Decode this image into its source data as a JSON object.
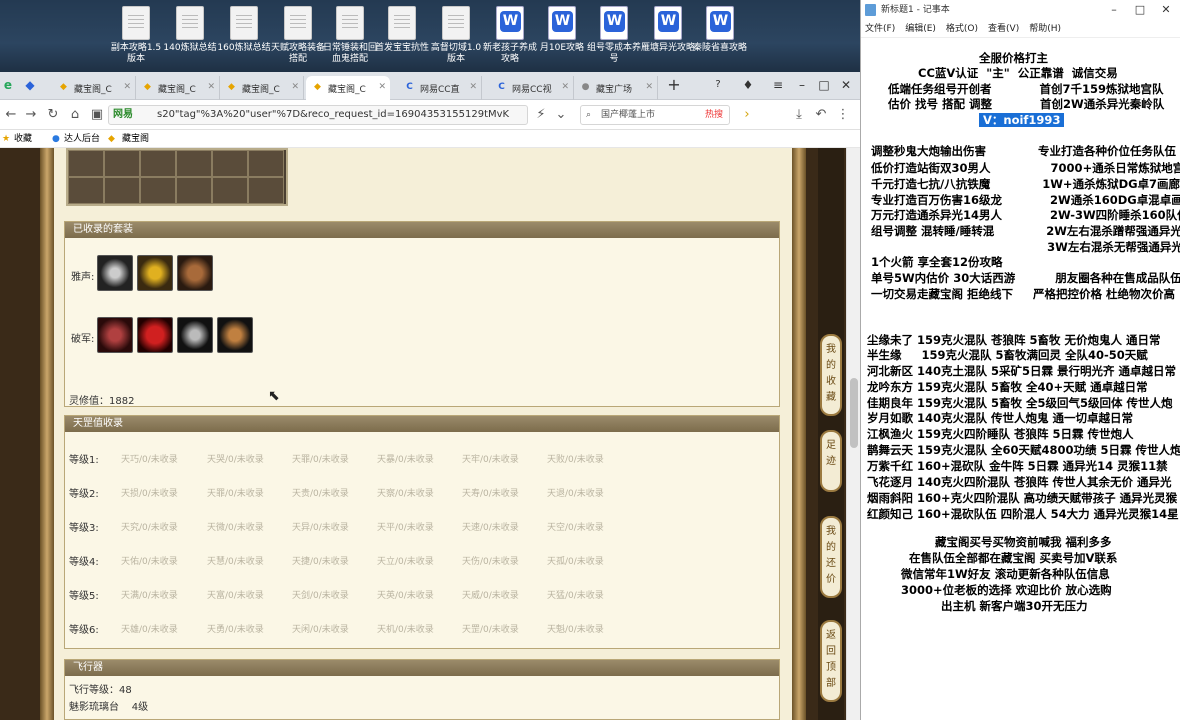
{
  "desktop": {
    "icons": [
      {
        "label": "副本攻略1.5版本",
        "kind": "doc"
      },
      {
        "label": "140炼狱总结",
        "kind": "doc"
      },
      {
        "label": "160炼狱总结",
        "kind": "doc"
      },
      {
        "label": "天赋攻略装备搭配",
        "kind": "doc"
      },
      {
        "label": "日常锤装和回血鬼搭配",
        "kind": "doc"
      },
      {
        "label": "首发宝宝抗性",
        "kind": "doc"
      },
      {
        "label": "高督切域1.0版本",
        "kind": "doc"
      },
      {
        "label": "新老孩子养成攻略",
        "kind": "wps"
      },
      {
        "label": "月10E攻略",
        "kind": "wps"
      },
      {
        "label": "组号零成本养号",
        "kind": "wps"
      },
      {
        "label": "雁塘异光攻略",
        "kind": "wps"
      },
      {
        "label": "秦陵省喜攻略",
        "kind": "wps"
      }
    ]
  },
  "browser": {
    "tabs": [
      {
        "label": "藏宝阁_C",
        "active": false
      },
      {
        "label": "藏宝阁_C",
        "active": false
      },
      {
        "label": "藏宝阁_C",
        "active": false
      },
      {
        "label": "藏宝阁_C",
        "active": true
      },
      {
        "label": "网易CC直",
        "active": false
      },
      {
        "label": "网易CC视",
        "active": false
      },
      {
        "label": "藏宝广场",
        "active": false
      }
    ],
    "url": "s20\"tag\"%3A%20\"user\"%7D&reco_request_id=16904353155129tMvK",
    "url_prefix": "网易",
    "search_placeholder": "国产椰蓬上市",
    "hot_label": "热搜",
    "bookmarks": [
      "收藏",
      "达人后台",
      "藏宝阁"
    ]
  },
  "panels": {
    "suits": {
      "title": "已收录的套装",
      "row1_label": "雅声:",
      "row2_label": "破军:",
      "lingxiu": "灵修值：1882"
    },
    "tiangang": {
      "title": "天罡值收录",
      "levels": [
        {
          "label": "等级1:",
          "items": [
            "天巧/0/未收录",
            "天哭/0/未收录",
            "天罪/0/未收录",
            "天暴/0/未收录",
            "天牢/0/未收录",
            "天败/0/未收录"
          ]
        },
        {
          "label": "等级2:",
          "items": [
            "天损/0/未收录",
            "天罪/0/未收录",
            "天贵/0/未收录",
            "天察/0/未收录",
            "天寿/0/未收录",
            "天退/0/未收录"
          ]
        },
        {
          "label": "等级3:",
          "items": [
            "天究/0/未收录",
            "天微/0/未收录",
            "天异/0/未收录",
            "天平/0/未收录",
            "天速/0/未收录",
            "天空/0/未收录"
          ]
        },
        {
          "label": "等级4:",
          "items": [
            "天佑/0/未收录",
            "天慧/0/未收录",
            "天捷/0/未收录",
            "天立/0/未收录",
            "天伤/0/未收录",
            "天孤/0/未收录"
          ]
        },
        {
          "label": "等级5:",
          "items": [
            "天满/0/未收录",
            "天富/0/未收录",
            "天剑/0/未收录",
            "天英/0/未收录",
            "天威/0/未收录",
            "天猛/0/未收录"
          ]
        },
        {
          "label": "等级6:",
          "items": [
            "天雄/0/未收录",
            "天勇/0/未收录",
            "天闲/0/未收录",
            "天机/0/未收录",
            "天罡/0/未收录",
            "天魁/0/未收录"
          ]
        }
      ]
    },
    "flight": {
      "title": "飞行器",
      "level": "飞行等级：48",
      "sub": "魅影琉璃台    4级"
    }
  },
  "side_buttons": [
    "我的收藏",
    "足迹",
    "我的还价",
    "返回顶部"
  ],
  "notepad": {
    "title": "新标题1 - 记事本",
    "menu": [
      "文件(F)",
      "编辑(E)",
      "格式(O)",
      "查看(V)",
      "帮助(H)"
    ],
    "selected": "V：noif1993",
    "lines": [
      "全服价格打主",
      "CC蓝V认证  \"主\"  公正靠谱  诚信交易",
      "低端任务组号开创者            首创7千159炼狱地宫队",
      "估价 找号 搭配 调整            首创2W通杀异光秦岭队",
      "调整秒鬼大炮输出伤害             专业打造各种价位任务队伍",
      "低价打造站街双30男人               7000+通杀日常炼狱地宫",
      "千元打造七抗/八抗铁魔             1W+通杀炼狱DG卓7画廊",
      "专业打造百万伤害16级龙            2W通杀160DG卓混卓画",
      "万元打造通杀异光14男人            2W-3W四阶睡杀160队伍",
      "组号调整 混转睡/睡转混             2W左右混杀蹭帮强通异光",
      "                                            3W左右混杀无帮强通异光",
      "1个火箭 享全套12份攻略",
      "单号5W内估价 30大话西游          朋友圈各种在售成品队伍",
      "一切交易走藏宝阁 拒绝线下     严格把控价格 杜绝物次价高",
      "尘缘未了 159克火混队 苍狼阵 5畜牧 无价炮鬼人 通日常",
      "半生缘     159克火混队 5畜牧满回灵 全队40-50天赋",
      "河北新区 140克土混队 5采矿5日霖 景行明光齐 通卓越日常",
      "龙吟东方 159克火混队 5畜牧 全40+天赋 通卓越日常",
      "佳期良年 159克火混队 5畜牧 全5级回气5级回体 传世人炮",
      "岁月如歌 140克火混队 传世人炮鬼 通一切卓越日常",
      "江枫渔火 159克火四阶睡队 苍狼阵 5日霖 传世炮人",
      "鹊舞云天 159克火混队 全60天赋4800功绩 5日霖 传世人炮",
      "万紫千红 160+混砍队 金牛阵 5日霖 通异光14 灵猴11禁",
      "飞花逐月 140克火四阶混队 苍狼阵 传世人其余无价 通异光",
      "烟雨斜阳 160+克火四阶混队 高功绩天赋带孩子 通异光灵猴",
      "红颜知己 160+混砍队伍 四阶混人 54大力 通异光灵猴14星",
      "藏宝阁买号买物资前喊我 福利多多",
      "在售队伍全部都在藏宝阁 买卖号加V联系",
      "微信常年1W好友 滚动更新各种队伍信息",
      "3000+位老板的选择 欢迎比价 放心选购",
      "出主机 新客户端30开无压力"
    ]
  }
}
